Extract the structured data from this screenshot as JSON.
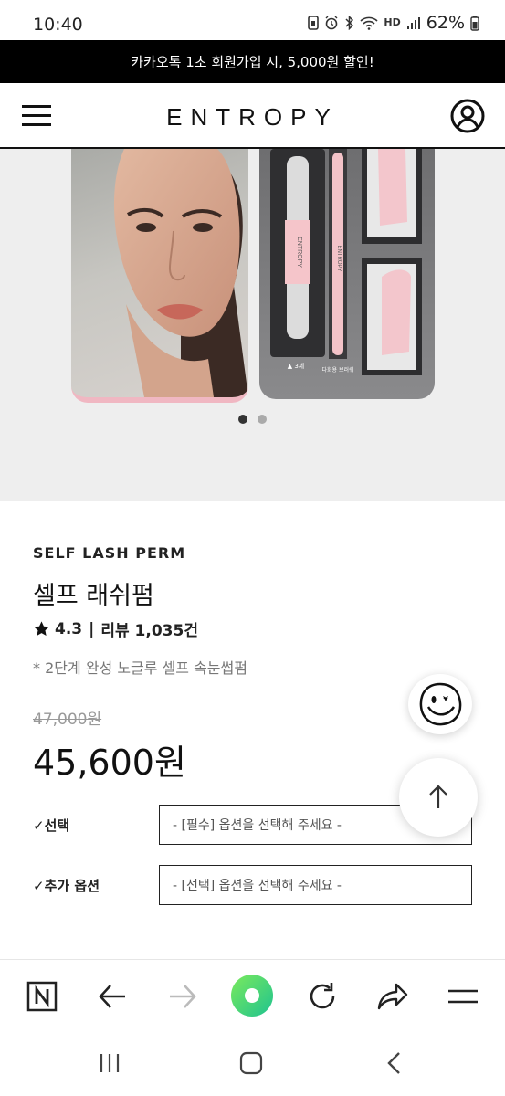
{
  "status_bar": {
    "time": "10:40",
    "battery": "62%",
    "icons": [
      "sim-icon",
      "alarm-icon",
      "bluetooth-icon",
      "wifi-icon",
      "hd-voice-icon",
      "signal-icon",
      "battery-icon"
    ],
    "hd_label": "HD"
  },
  "promo": {
    "text": "카카오톡 1초 회원가입 시, 5,000원 할인!"
  },
  "header": {
    "brand": "ENTROPY",
    "menu_icon": "hamburger-menu-icon",
    "account_icon": "user-account-icon"
  },
  "hero": {
    "slides_total": 2,
    "active_slide": 1,
    "kit_labels": {
      "tube_brand": "ENTROPY",
      "step_label": "▲ 3제",
      "tool_label": "다회용 브러쉬"
    }
  },
  "product": {
    "eyebrow": "SELF LASH PERM",
    "title": "셀프 래쉬펌",
    "rating": "4.3",
    "separator": "|",
    "reviews": "리뷰 1,035건",
    "description": "* 2단계 완성 노글루 셀프 속눈썹펌",
    "original_price": "47,000원",
    "price": "45,600원"
  },
  "options": [
    {
      "label": "✓선택",
      "placeholder": "- [필수] 옵션을 선택해 주세요 -"
    },
    {
      "label": "✓추가 옵션",
      "placeholder": "- [선택] 옵션을 선택해 주세요 -"
    }
  ],
  "floating": {
    "chat_icon": "smiley-chat-icon",
    "top_icon": "arrow-up-icon"
  },
  "browser_toolbar": {
    "items": [
      "naver-home-icon",
      "back-arrow-icon",
      "forward-arrow-icon",
      "green-dot-icon",
      "refresh-icon",
      "share-icon",
      "menu-icon"
    ],
    "accent": "#2ed47a"
  },
  "android_nav": {
    "items": [
      "recents-icon",
      "home-icon",
      "back-icon"
    ]
  }
}
